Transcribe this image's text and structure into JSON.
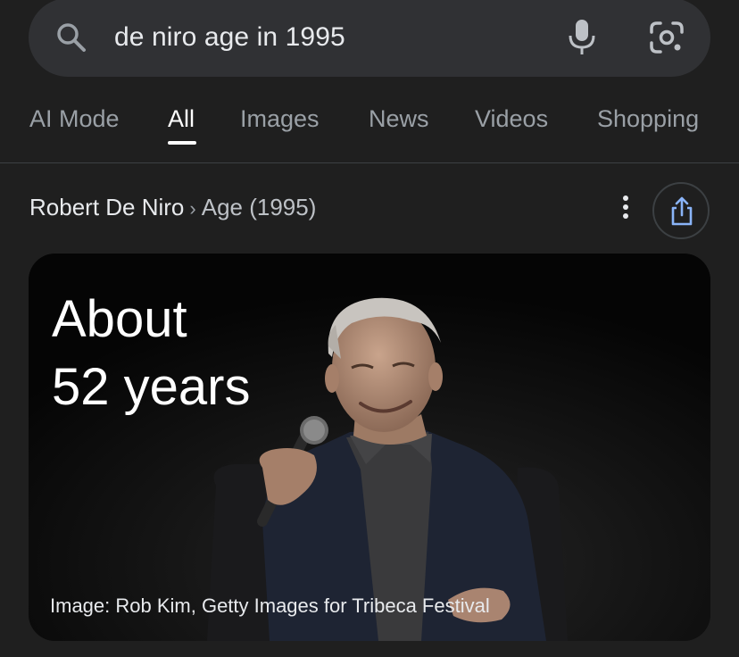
{
  "search": {
    "query": "de niro age in 1995",
    "icons": {
      "search": "search-icon",
      "voice": "mic-icon",
      "lens": "google-lens-icon"
    }
  },
  "tabs": [
    {
      "label": "AI Mode",
      "active": false
    },
    {
      "label": "All",
      "active": true
    },
    {
      "label": "Images",
      "active": false
    },
    {
      "label": "News",
      "active": false
    },
    {
      "label": "Videos",
      "active": false
    },
    {
      "label": "Shopping",
      "active": false
    }
  ],
  "breadcrumb": {
    "entity": "Robert De Niro",
    "separator": "›",
    "attribute": "Age (1995)"
  },
  "answer": {
    "line1": "About",
    "line2": "52 years",
    "caption": "Image: Rob Kim, Getty Images for Tribeca Festival"
  },
  "colors": {
    "background": "#1f1f1f",
    "search_bar": "#303134",
    "active_tab": "#ffffff",
    "inactive_tab": "#9aa0a6",
    "share_accent": "#8ab4f8"
  }
}
